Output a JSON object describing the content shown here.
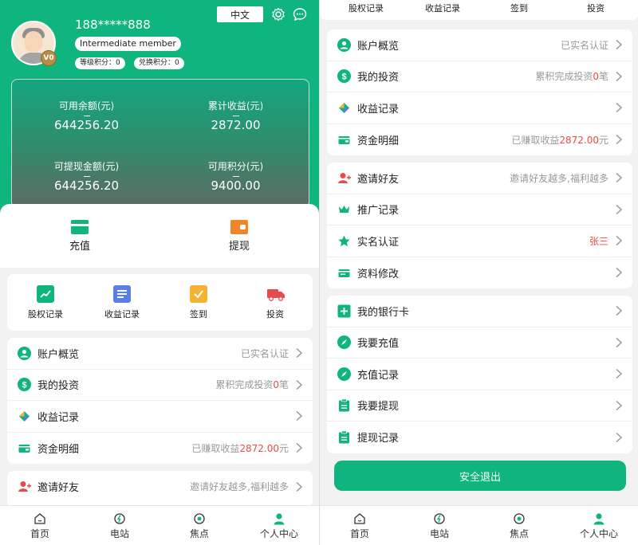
{
  "profile": {
    "phone": "188*****888",
    "member_level": "Intermediate member",
    "level_points": "等级积分：0",
    "exchange_points": "兑换积分：0",
    "vip_badge": "V0",
    "language_button": "中文"
  },
  "balance": {
    "available_label": "可用余额(元)",
    "available_value": "644256.20",
    "earnings_label": "累计收益(元)",
    "earnings_value": "2872.00",
    "withdrawable_label": "可提现金额(元)",
    "withdrawable_value": "644256.20",
    "points_label": "可用积分(元)",
    "points_value": "9400.00"
  },
  "actions": {
    "recharge": "充值",
    "withdraw": "提现"
  },
  "quick": {
    "equity": "股权记录",
    "income": "收益记录",
    "signin": "签到",
    "invest": "投资"
  },
  "menu": {
    "account_overview": "账户概览",
    "account_status": "已实名认证",
    "my_investment": "我的投资",
    "invest_prefix": "累积完成投资",
    "invest_count": "0",
    "invest_suffix": "笔",
    "income_records": "收益记录",
    "fund_details": "资金明细",
    "fund_prefix": "已赚取收益",
    "fund_amount": "2872.00",
    "fund_suffix": "元",
    "invite_friends": "邀请好友",
    "invite_hint": "邀请好友越多,福利越多",
    "promo_records": "推广记录",
    "realname": "实名认证",
    "realname_value": "张三",
    "edit_profile": "资料修改",
    "bank_card": "我的银行卡",
    "recharge": "我要充值",
    "recharge_records": "充值记录",
    "withdraw": "我要提现",
    "withdraw_records": "提现记录",
    "logout": "安全退出"
  },
  "tabbar": {
    "home": "首页",
    "station": "电站",
    "focus": "焦点",
    "me": "个人中心"
  },
  "colors": {
    "primary": "#0fb47e",
    "accent_red": "#e84b4b",
    "icon_orange": "#f0852a",
    "icon_blue": "#5b7ee5",
    "icon_yellow": "#f5b335"
  }
}
